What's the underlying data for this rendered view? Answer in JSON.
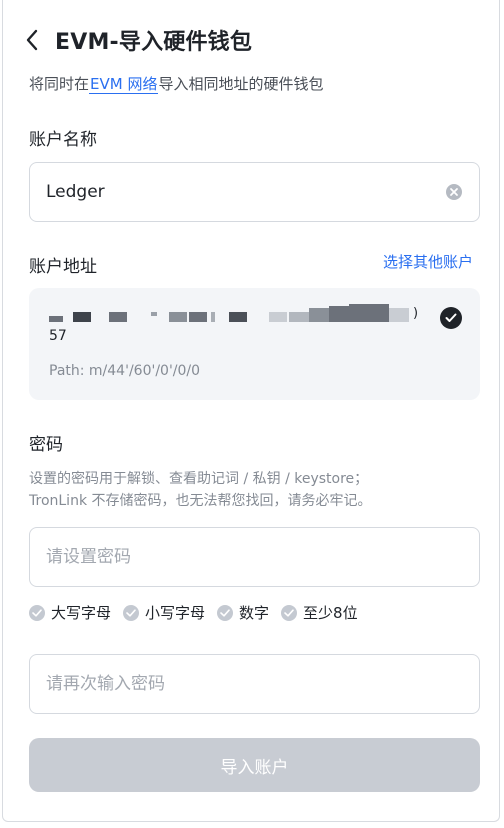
{
  "header": {
    "title": "EVM-导入硬件钱包"
  },
  "subtitle": {
    "prefix": "将同时在",
    "link": "EVM 网络",
    "suffix": "导入相同地址的硬件钱包"
  },
  "account_name": {
    "label": "账户名称",
    "value": "Ledger"
  },
  "account_address": {
    "label": "账户地址",
    "select_other": "选择其他账户",
    "address_tail": "57",
    "address_edge": ")",
    "path": "Path: m/44'/60'/0'/0/0"
  },
  "password": {
    "label": "密码",
    "hint_line1": "设置的密码用于解锁、查看助记词 / 私钥 / keystore；",
    "hint_line2": "TronLink 不存储密码，也无法帮您找回，请务必牢记。",
    "placeholder": "请设置密码",
    "rules": [
      "大写字母",
      "小写字母",
      "数字",
      "至少8位"
    ],
    "confirm_placeholder": "请再次输入密码"
  },
  "submit": {
    "label": "导入账户"
  },
  "colors": {
    "accent": "#2a6ff0",
    "disabled_button": "#c8ccd3",
    "card_bg": "#f3f5f8"
  }
}
